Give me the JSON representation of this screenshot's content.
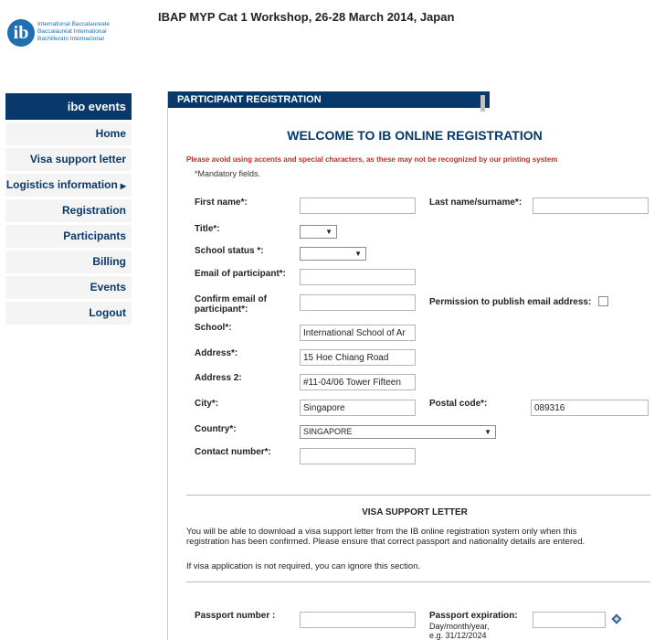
{
  "logo": {
    "glyph": "ib",
    "lines": [
      "International Baccalaureate",
      "Baccalauréat International",
      "Bachillerato Internacional"
    ]
  },
  "header": {
    "title": "IBAP MYP Cat 1 Workshop, 26-28 March 2014, Japan"
  },
  "sidebar": {
    "heading": "ibo events",
    "items": [
      {
        "label": "Home"
      },
      {
        "label": "Visa support letter"
      },
      {
        "label": "Logistics information",
        "has_submenu": true
      },
      {
        "label": "Registration"
      },
      {
        "label": "Participants"
      },
      {
        "label": "Billing"
      },
      {
        "label": "Events"
      },
      {
        "label": "Logout"
      }
    ]
  },
  "main": {
    "tab": "PARTICIPANT REGISTRATION",
    "welcome": "WELCOME TO IB ONLINE REGISTRATION",
    "warning": "Please avoid using accents and special characters, as these may not be recognized by our printing system",
    "mandatory": "*Mandatory fields."
  },
  "form": {
    "first_name": {
      "label": "First name*:",
      "value": ""
    },
    "last_name": {
      "label": "Last name/surname*:",
      "value": ""
    },
    "title": {
      "label": "Title*:",
      "value": ""
    },
    "school_status": {
      "label": "School status *:",
      "value": ""
    },
    "email": {
      "label": "Email of participant*:",
      "value": ""
    },
    "confirm_email": {
      "label_line1": "Confirm email of",
      "label_line2": "participant*:",
      "value": ""
    },
    "permission": {
      "label": "Permission to publish email address:"
    },
    "school": {
      "label": "School*:",
      "value": "International School of Ar"
    },
    "address": {
      "label": "Address*:",
      "value": "15 Hoe Chiang Road"
    },
    "address2": {
      "label": "Address 2:",
      "value": "#11-04/06 Tower Fifteen"
    },
    "city": {
      "label": "City*:",
      "value": "Singapore"
    },
    "postal": {
      "label": "Postal code*:",
      "value": "089316"
    },
    "country": {
      "label": "Country*:",
      "value": "SINGAPORE"
    },
    "contact": {
      "label": "Contact number*:",
      "value": ""
    }
  },
  "visa": {
    "title": "VISA SUPPORT LETTER",
    "para1_line1": "You will be able to download a visa support letter from the IB online registration system only when this",
    "para1_line2": "registration has been confirmed. Please ensure that correct passport and nationality details are entered.",
    "para2": "If visa application is not required, you can ignore this section.",
    "passport_number": {
      "label": "Passport number :",
      "value": ""
    },
    "passport_expiration": {
      "label": "Passport expiration:",
      "hint1": "Day/month/year,",
      "hint2": "e.g. 31/12/2024",
      "value": ""
    }
  },
  "colors": {
    "navy": "#08396a",
    "warning_red": "#b8342b",
    "logo_blue": "#1f6fb4"
  },
  "icons": {
    "calendar": "calendar-icon",
    "submenu": "triangle-right-icon",
    "dropdown": "dropdown-arrow-icon"
  }
}
